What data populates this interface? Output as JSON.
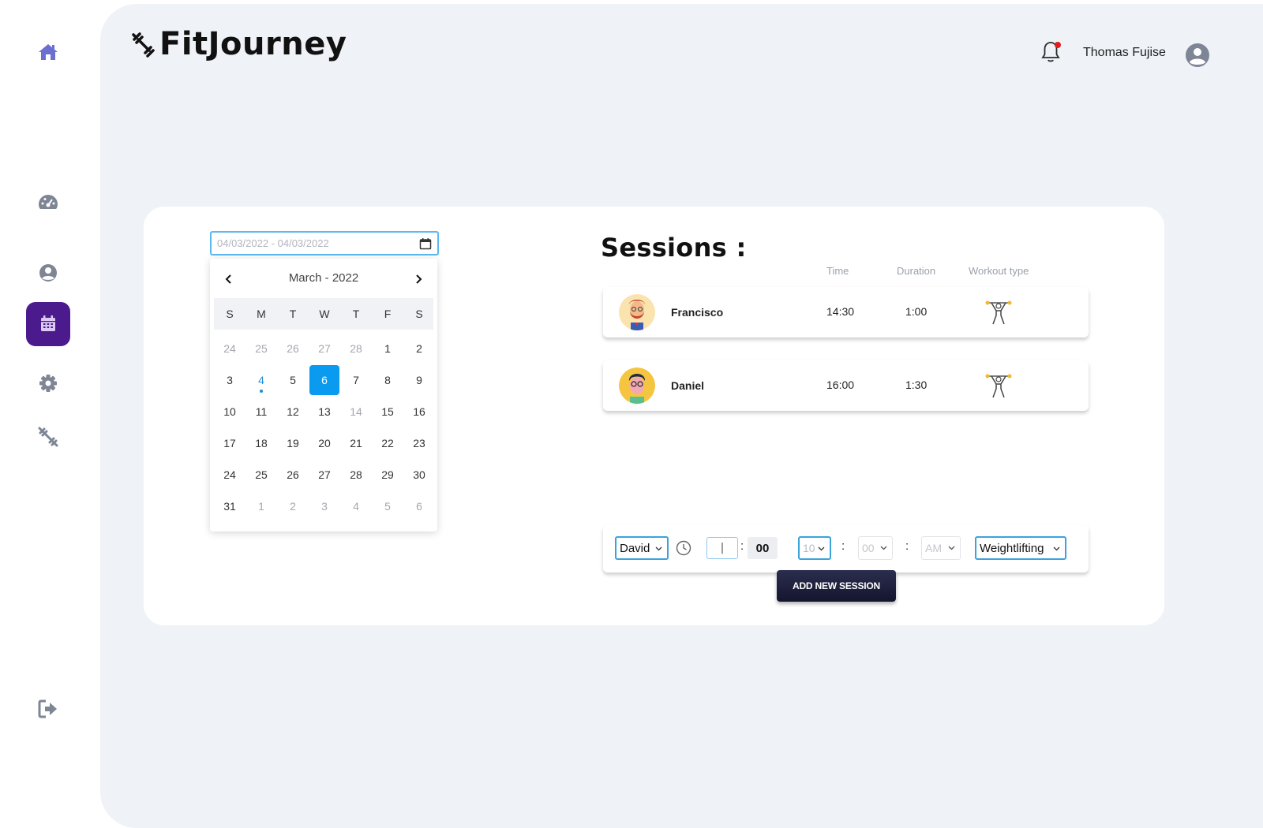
{
  "app": {
    "title": "FitJourney"
  },
  "header": {
    "user_name": "Thomas Fujise",
    "notification_active": true
  },
  "sidebar": {
    "items": [
      {
        "name": "home",
        "icon": "home-icon"
      },
      {
        "name": "dashboard",
        "icon": "speedometer-icon"
      },
      {
        "name": "profile",
        "icon": "user-circle-icon"
      },
      {
        "name": "calendar",
        "icon": "calendar-icon",
        "active": true
      },
      {
        "name": "settings",
        "icon": "gear-icon"
      },
      {
        "name": "workout",
        "icon": "dumbbell-icon"
      },
      {
        "name": "logout",
        "icon": "logout-icon"
      }
    ]
  },
  "date_picker": {
    "placeholder": "04/03/2022 - 04/03/2022",
    "month_label": "March - 2022",
    "weekdays": [
      "S",
      "M",
      "T",
      "W",
      "T",
      "F",
      "S"
    ],
    "days": [
      {
        "d": "24",
        "s": "muted"
      },
      {
        "d": "25",
        "s": "muted"
      },
      {
        "d": "26",
        "s": "muted"
      },
      {
        "d": "27",
        "s": "muted"
      },
      {
        "d": "28",
        "s": "muted"
      },
      {
        "d": "1",
        "s": ""
      },
      {
        "d": "2",
        "s": ""
      },
      {
        "d": "3",
        "s": ""
      },
      {
        "d": "4",
        "s": "today"
      },
      {
        "d": "5",
        "s": ""
      },
      {
        "d": "6",
        "s": "selected"
      },
      {
        "d": "7",
        "s": ""
      },
      {
        "d": "8",
        "s": ""
      },
      {
        "d": "9",
        "s": ""
      },
      {
        "d": "10",
        "s": ""
      },
      {
        "d": "11",
        "s": ""
      },
      {
        "d": "12",
        "s": ""
      },
      {
        "d": "13",
        "s": ""
      },
      {
        "d": "14",
        "s": "muted"
      },
      {
        "d": "15",
        "s": ""
      },
      {
        "d": "16",
        "s": ""
      },
      {
        "d": "17",
        "s": ""
      },
      {
        "d": "18",
        "s": ""
      },
      {
        "d": "19",
        "s": ""
      },
      {
        "d": "20",
        "s": ""
      },
      {
        "d": "21",
        "s": ""
      },
      {
        "d": "22",
        "s": ""
      },
      {
        "d": "23",
        "s": ""
      },
      {
        "d": "24",
        "s": ""
      },
      {
        "d": "25",
        "s": ""
      },
      {
        "d": "26",
        "s": ""
      },
      {
        "d": "27",
        "s": ""
      },
      {
        "d": "28",
        "s": ""
      },
      {
        "d": "29",
        "s": ""
      },
      {
        "d": "30",
        "s": ""
      },
      {
        "d": "31",
        "s": ""
      },
      {
        "d": "1",
        "s": "muted"
      },
      {
        "d": "2",
        "s": "muted"
      },
      {
        "d": "3",
        "s": "muted"
      },
      {
        "d": "4",
        "s": "muted"
      },
      {
        "d": "5",
        "s": "muted"
      },
      {
        "d": "6",
        "s": "muted"
      }
    ]
  },
  "sessions": {
    "title": "Sessions :",
    "columns": {
      "time": "Time",
      "duration": "Duration",
      "type": "Workout type"
    },
    "rows": [
      {
        "name": "Francisco",
        "time": "14:30",
        "duration": "1:00",
        "type_icon": "weightlifter-icon"
      },
      {
        "name": "Daniel",
        "time": "16:00",
        "duration": "1:30",
        "type_icon": "weightlifter-icon"
      }
    ]
  },
  "form": {
    "trainer": "David",
    "hours_value": "|",
    "minutes_value": "00",
    "hour_select": "10",
    "minute_select": "00",
    "ampm_select": "AM",
    "workout_type": "Weightlifting",
    "add_button": "ADD NEW SESSION"
  },
  "colors": {
    "accent": "#4b1a8c",
    "selected_day": "#0a9bf0",
    "background": "#eff2f7",
    "button": "#1d1f3b"
  }
}
